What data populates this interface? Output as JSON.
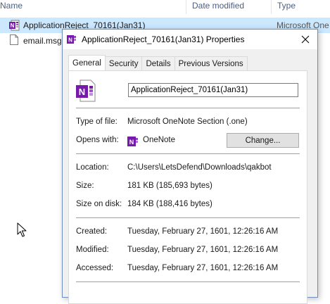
{
  "explorer": {
    "columns": {
      "name": "Name",
      "date_modified": "Date modified",
      "type": "Type"
    },
    "files": [
      {
        "name": "ApplicationReject_70161(Jan31)",
        "type": "Microsoft One",
        "icon": "onenote-icon",
        "selected": true
      },
      {
        "name": "email.msg",
        "type": "",
        "icon": "document-icon",
        "selected": false
      }
    ]
  },
  "dialog": {
    "title": "ApplicationReject_70161(Jan31) Properties",
    "tabs": [
      "General",
      "Security",
      "Details",
      "Previous Versions"
    ],
    "active_tab": "General",
    "file_name": "ApplicationReject_70161(Jan31)",
    "type_label": "Type of file:",
    "type_value": "Microsoft OneNote Section (.one)",
    "opens_label": "Opens with:",
    "opens_value": "OneNote",
    "change_label": "Change...",
    "location_label": "Location:",
    "location_value": "C:\\Users\\LetsDefend\\Downloads\\qakbot",
    "size_label": "Size:",
    "size_value": "181 KB (185,693 bytes)",
    "size_disk_label": "Size on disk:",
    "size_disk_value": "184 KB (188,416 bytes)",
    "created_label": "Created:",
    "created_value": "Tuesday, February 27, 1601, 12:26:16 AM",
    "modified_label": "Modified:",
    "modified_value": "Tuesday, February 27, 1601, 12:26:16 AM",
    "accessed_label": "Accessed:",
    "accessed_value": "Tuesday, February 27, 1601, 12:26:16 AM",
    "close_icon": "close-icon"
  },
  "colors": {
    "onenote_purple": "#7719aa",
    "selection": "#cce8ff",
    "dialog_border": "#6d8fbf"
  }
}
